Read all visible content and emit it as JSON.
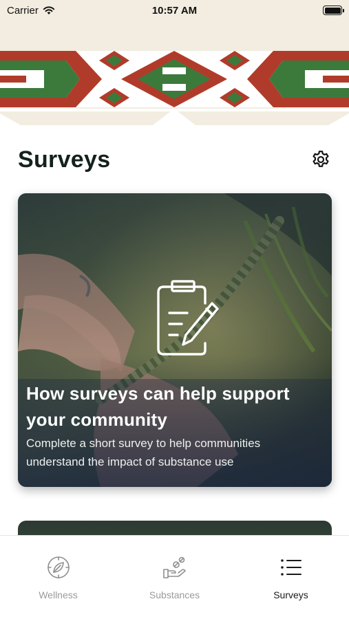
{
  "status_bar": {
    "carrier": "Carrier",
    "time": "10:57 AM"
  },
  "header": {
    "title": "Surveys"
  },
  "icons": {
    "settings": "gear-icon",
    "card": "clipboard-edit-icon",
    "wifi": "wifi-icon",
    "battery": "battery-icon"
  },
  "card": {
    "title": "How surveys can help support your community",
    "description": "Complete a short survey to help communities understand the impact of substance use"
  },
  "tabs": [
    {
      "label": "Wellness",
      "icon": "leaf-compass-icon",
      "active": false
    },
    {
      "label": "Substances",
      "icon": "hand-pills-icon",
      "active": false
    },
    {
      "label": "Surveys",
      "icon": "list-icon",
      "active": true
    }
  ],
  "colors": {
    "banner_cream": "#f2ede0",
    "banner_red": "#b13b2a",
    "banner_green": "#3c7a3c",
    "title_dark": "#14211d"
  }
}
